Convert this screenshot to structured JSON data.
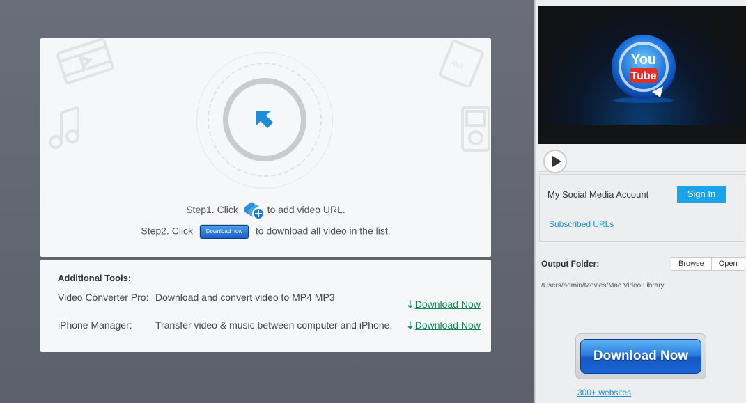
{
  "main": {
    "step1_prefix": "Step1. Click",
    "step1_suffix": "to add video URL.",
    "step2_prefix": "Step2. Click",
    "step2_button": "Download now",
    "step2_suffix": "to download all video in the list."
  },
  "tools": {
    "title": "Additional Tools:",
    "items": [
      {
        "name": "Video Converter Pro:",
        "desc": "Download and convert video to MP4 MP3",
        "link": "Download Now"
      },
      {
        "name": "iPhone Manager:",
        "desc": "Transfer video & music between computer and iPhone.",
        "link": "Download Now"
      }
    ]
  },
  "sidebar": {
    "logo_text_you": "You",
    "logo_text_tube": "Tube",
    "social_label": "My Social Media Account",
    "signin_label": "Sign In",
    "subscribed_label": "Subscribed URLs",
    "output_label": "Output Folder:",
    "browse_label": "Browse",
    "open_label": "Open",
    "output_path": "/Users/admin/Movies/Mac Video Library",
    "download_label": "Download Now",
    "websites_label": "300+ websites"
  },
  "icons": {
    "add_url": "add-url-icon",
    "target_arrow": "arrow-up-left-icon",
    "play": "play-icon",
    "download_arrow": "download-arrow-icon"
  },
  "colors": {
    "accent_blue": "#1aa3e8",
    "link_green": "#0d8a54",
    "arrow_blue": "#1a8fd8"
  }
}
